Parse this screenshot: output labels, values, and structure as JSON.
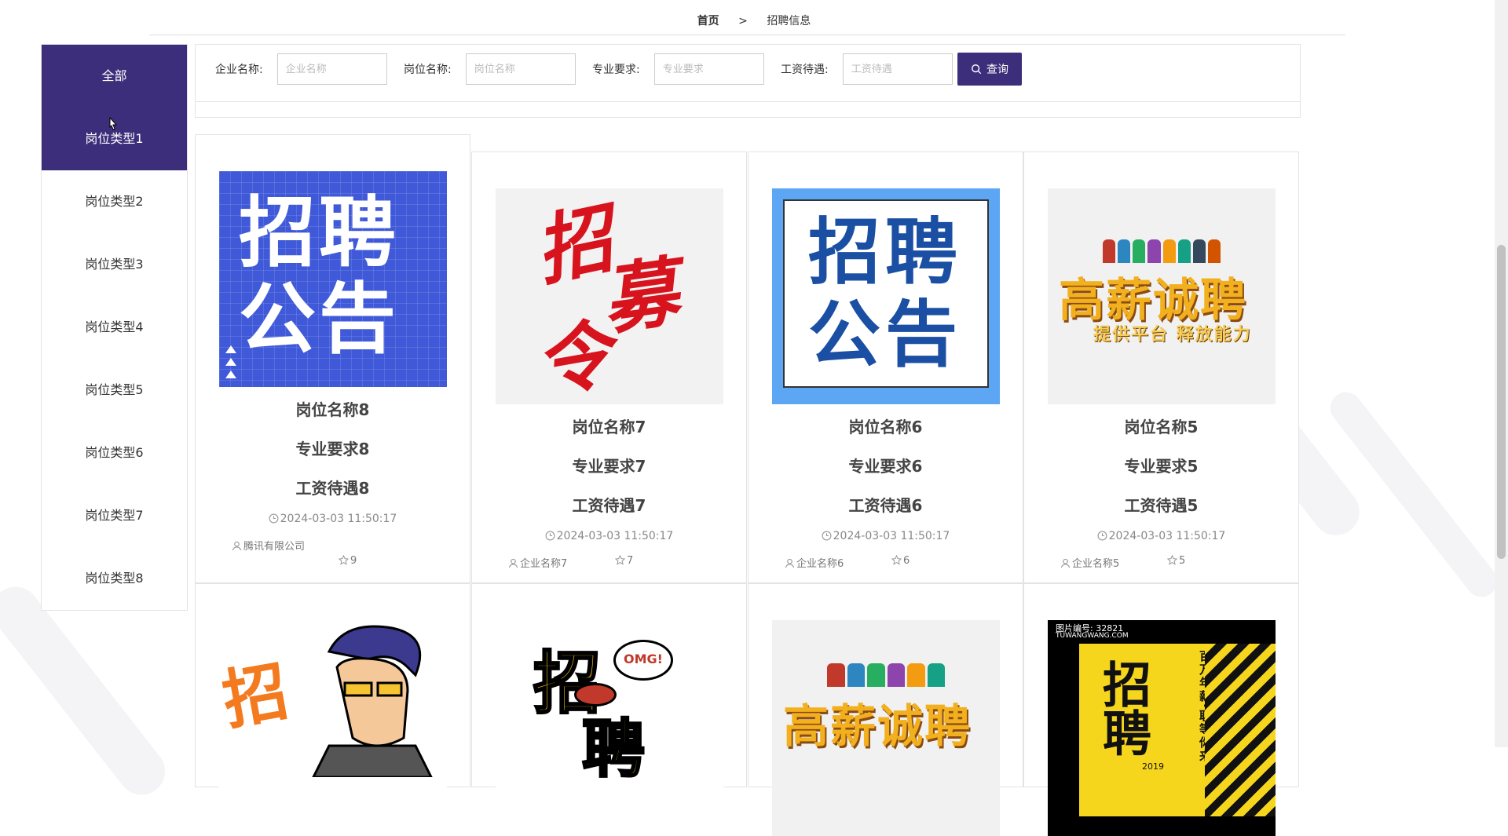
{
  "breadcrumb": {
    "home": "首页",
    "separator": ">",
    "current": "招聘信息"
  },
  "sidebar": {
    "items": [
      {
        "label": "全部",
        "active": true
      },
      {
        "label": "岗位类型1",
        "active": true
      },
      {
        "label": "岗位类型2",
        "active": false
      },
      {
        "label": "岗位类型3",
        "active": false
      },
      {
        "label": "岗位类型4",
        "active": false
      },
      {
        "label": "岗位类型5",
        "active": false
      },
      {
        "label": "岗位类型6",
        "active": false
      },
      {
        "label": "岗位类型7",
        "active": false
      },
      {
        "label": "岗位类型8",
        "active": false
      }
    ]
  },
  "search": {
    "company": {
      "label": "企业名称:",
      "placeholder": "企业名称",
      "value": ""
    },
    "position": {
      "label": "岗位名称:",
      "placeholder": "岗位名称",
      "value": ""
    },
    "major": {
      "label": "专业要求:",
      "placeholder": "专业要求",
      "value": ""
    },
    "salary": {
      "label": "工资待遇:",
      "placeholder": "工资待遇",
      "value": ""
    },
    "button_label": "查询",
    "button_icon": "search-icon"
  },
  "cards": [
    {
      "title": "岗位名称8",
      "major": "专业要求8",
      "salary": "工资待遇8",
      "date": "2024-03-03 11:50:17",
      "company": "腾讯有限公司",
      "stars": "9",
      "image": "招聘公告"
    },
    {
      "title": "岗位名称7",
      "major": "专业要求7",
      "salary": "工资待遇7",
      "date": "2024-03-03 11:50:17",
      "company": "企业名称7",
      "stars": "7",
      "image": "招募令"
    },
    {
      "title": "岗位名称6",
      "major": "专业要求6",
      "salary": "工资待遇6",
      "date": "2024-03-03 11:50:17",
      "company": "企业名称6",
      "stars": "6",
      "image": "招聘公告"
    },
    {
      "title": "岗位名称5",
      "major": "专业要求5",
      "salary": "工资待遇5",
      "date": "2024-03-03 11:50:17",
      "company": "企业名称5",
      "stars": "5",
      "image": "高薪诚聘 提供平台 释放能力"
    }
  ],
  "thumb_text": {
    "a1_line1": "招聘",
    "a1_line2": "公告",
    "a2_c1": "招",
    "a2_c2": "募",
    "a2_c3": "令",
    "a3_line1": "招聘",
    "a3_line2": "公告",
    "a4_title": "高薪诚聘",
    "a4_sub": "提供平台 释放能力",
    "a5_char": "招",
    "a6_char1": "招",
    "a6_char2": "聘",
    "a6_bubble": "OMG!",
    "a7_title": "高薪诚聘",
    "a8_header": "图片编号: 32821",
    "a8_brand": "TUWANGWANG.COM",
    "a8_vertical": "百万年薪·职等你来",
    "a8_year": "2019",
    "a8_char": "招聘"
  },
  "colors": {
    "accent": "#3c2e7a"
  }
}
